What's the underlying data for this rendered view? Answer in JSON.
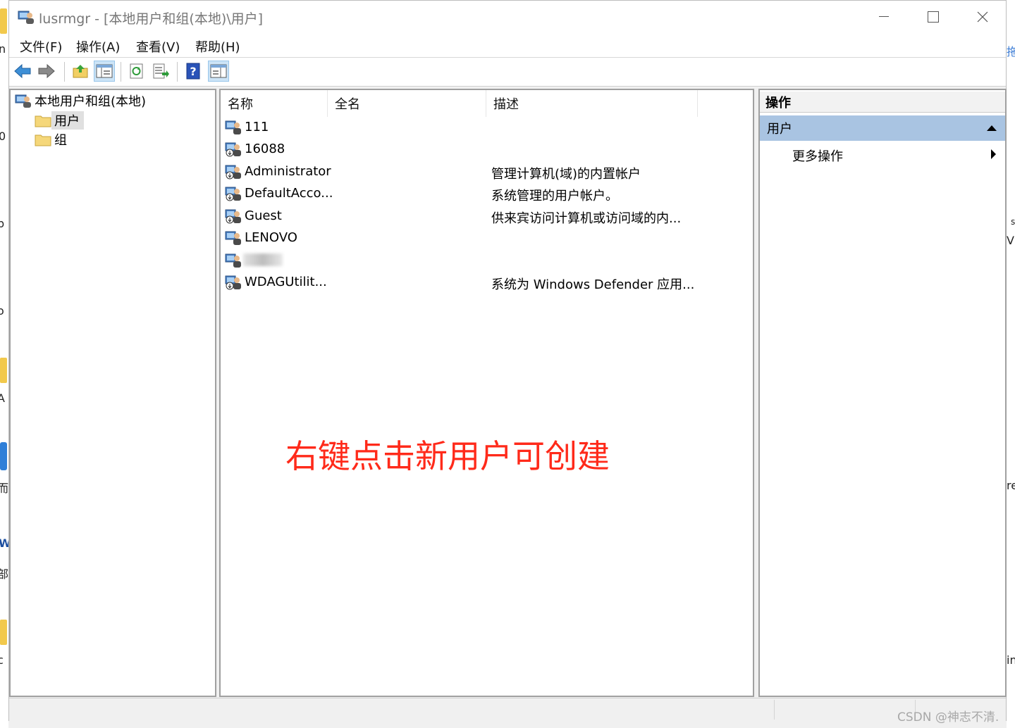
{
  "window": {
    "title": "lusrmgr - [本地用户和组(本地)\\用户]"
  },
  "menu": [
    "文件(F)",
    "操作(A)",
    "查看(V)",
    "帮助(H)"
  ],
  "toolbar_icons": [
    "back-arrow-icon",
    "forward-arrow-icon",
    "up-folder-icon",
    "show-tree-icon",
    "refresh-icon",
    "export-list-icon",
    "help-icon",
    "action-pane-icon"
  ],
  "tree": {
    "root": "本地用户和组(本地)",
    "items": [
      {
        "label": "用户",
        "selected": true
      },
      {
        "label": "组",
        "selected": false
      }
    ]
  },
  "list": {
    "columns": [
      "名称",
      "全名",
      "描述"
    ],
    "rows": [
      {
        "name": "111",
        "fullname": "",
        "desc": ""
      },
      {
        "name": "16088",
        "fullname": "",
        "desc": ""
      },
      {
        "name": "Administrator",
        "fullname": "",
        "desc": "管理计算机(域)的内置帐户"
      },
      {
        "name": "DefaultAcco...",
        "fullname": "",
        "desc": "系统管理的用户帐户。"
      },
      {
        "name": "Guest",
        "fullname": "",
        "desc": "供来宾访问计算机或访问域的内..."
      },
      {
        "name": "LENOVO",
        "fullname": "",
        "desc": ""
      },
      {
        "name": "",
        "fullname": "",
        "desc": ""
      },
      {
        "name": "WDAGUtilit...",
        "fullname": "",
        "desc": "系统为 Windows Defender 应用..."
      }
    ]
  },
  "annotation": "右键点击新用户可创建",
  "actions": {
    "header": "操作",
    "group": "用户",
    "item": "更多操作"
  },
  "desktop_fragments": {
    "left": [
      "n",
      "0",
      "b",
      "o",
      "A",
      "而",
      "W",
      "部",
      "c"
    ],
    "right": [
      "拖",
      "s",
      "Vi",
      "re",
      "in"
    ]
  },
  "watermark": "CSDN @神志不清."
}
